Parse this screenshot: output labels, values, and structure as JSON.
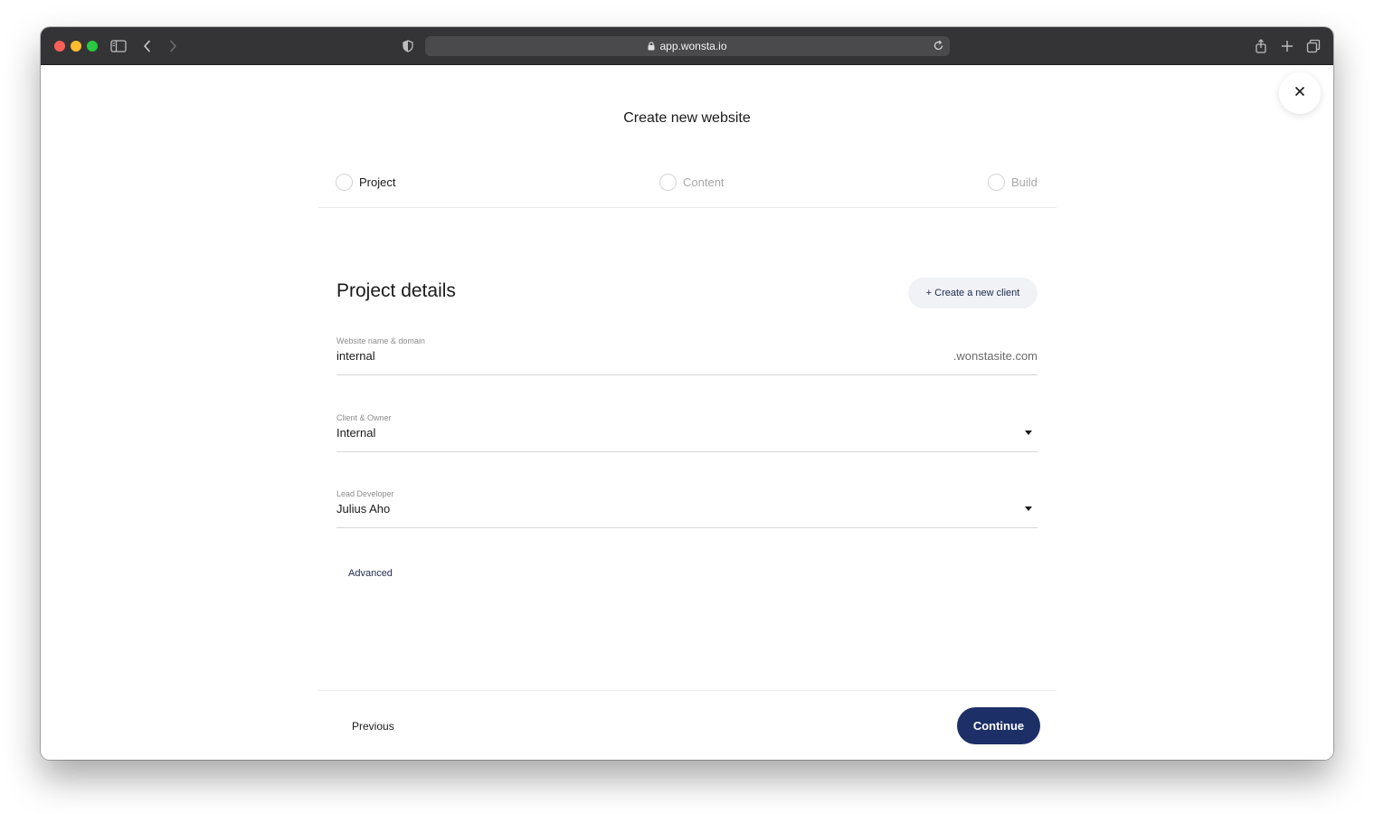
{
  "browser": {
    "url": "app.wonsta.io"
  },
  "page": {
    "title": "Create new website"
  },
  "steps": [
    {
      "label": "Project",
      "state": "active"
    },
    {
      "label": "Content",
      "state": "inactive"
    },
    {
      "label": "Build",
      "state": "inactive"
    }
  ],
  "section": {
    "title": "Project details",
    "new_client_label": "+ Create a new client"
  },
  "fields": {
    "website": {
      "label": "Website name & domain",
      "value": "internal",
      "suffix": ".wonstasite.com"
    },
    "client": {
      "label": "Client & Owner",
      "value": "Internal"
    },
    "developer": {
      "label": "Lead Developer",
      "value": "Julius Aho"
    }
  },
  "advanced_label": "Advanced",
  "footer": {
    "previous_label": "Previous",
    "continue_label": "Continue"
  },
  "colors": {
    "primary": "#1c2f66",
    "chrome": "#343436"
  }
}
